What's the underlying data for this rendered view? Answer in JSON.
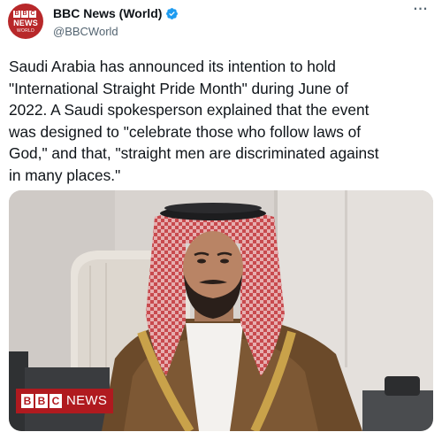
{
  "author": {
    "display_name": "BBC News (World)",
    "handle": "@BBCWorld",
    "verified": true,
    "avatar": {
      "logo_letters": [
        "B",
        "B",
        "C"
      ],
      "line1": "NEWS",
      "line2": "WORLD",
      "color": "#b8282a"
    }
  },
  "more_icon": "···",
  "tweet": {
    "text": "Saudi Arabia has announced its intention to hold\n\"International Straight Pride Month\" during June of\n2022. A Saudi spokesperson explained that the event\nwas designed to \"celebrate those who follow laws of\nGod,\" and that, \"straight men are discriminated against\nin many places.\""
  },
  "media": {
    "watermark": {
      "letters": [
        "B",
        "B",
        "C"
      ],
      "word": "NEWS",
      "color": "#b01a1f"
    }
  },
  "colors": {
    "verified": "#1d9bf0",
    "secondary_text": "#536471"
  }
}
